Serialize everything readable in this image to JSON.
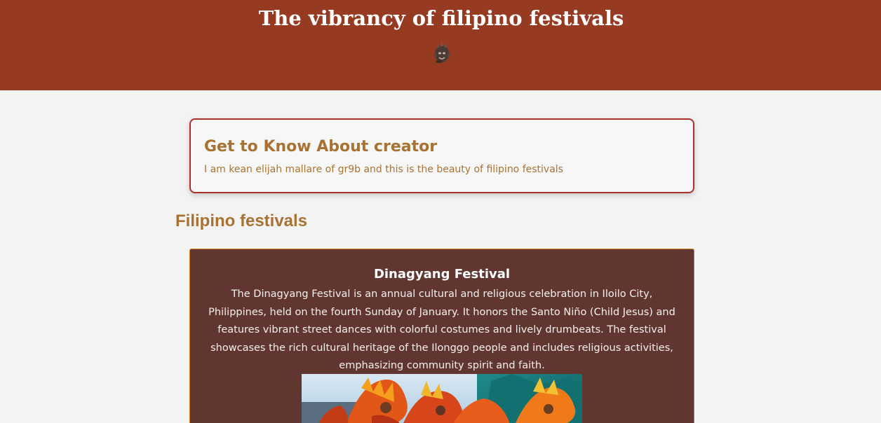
{
  "header": {
    "title": "The vibrancy of filipino festivals",
    "logo_icon": "festival-mask-icon",
    "background_color": "#963a21"
  },
  "about": {
    "title": "Get to Know About creator",
    "text": "I am kean elijah mallare of gr9b and this is the beauty of filipino festivals",
    "border_color": "#a8322a",
    "text_color": "#a87332"
  },
  "festivals_section": {
    "heading": "Filipino festivals",
    "items": [
      {
        "title": "Dinagyang Festival",
        "description": "The Dinagyang Festival is an annual cultural and religious celebration in Iloilo City, Philippines, held on the fourth Sunday of January. It honors the Santo Niño (Child Jesus) and features vibrant street dances with colorful costumes and lively drumbeats. The festival showcases the rich cultural heritage of the Ilonggo people and includes religious activities, emphasizing community spirit and faith.",
        "image_icon": "festival-dancers-photo",
        "background_color": "#623630"
      }
    ]
  }
}
